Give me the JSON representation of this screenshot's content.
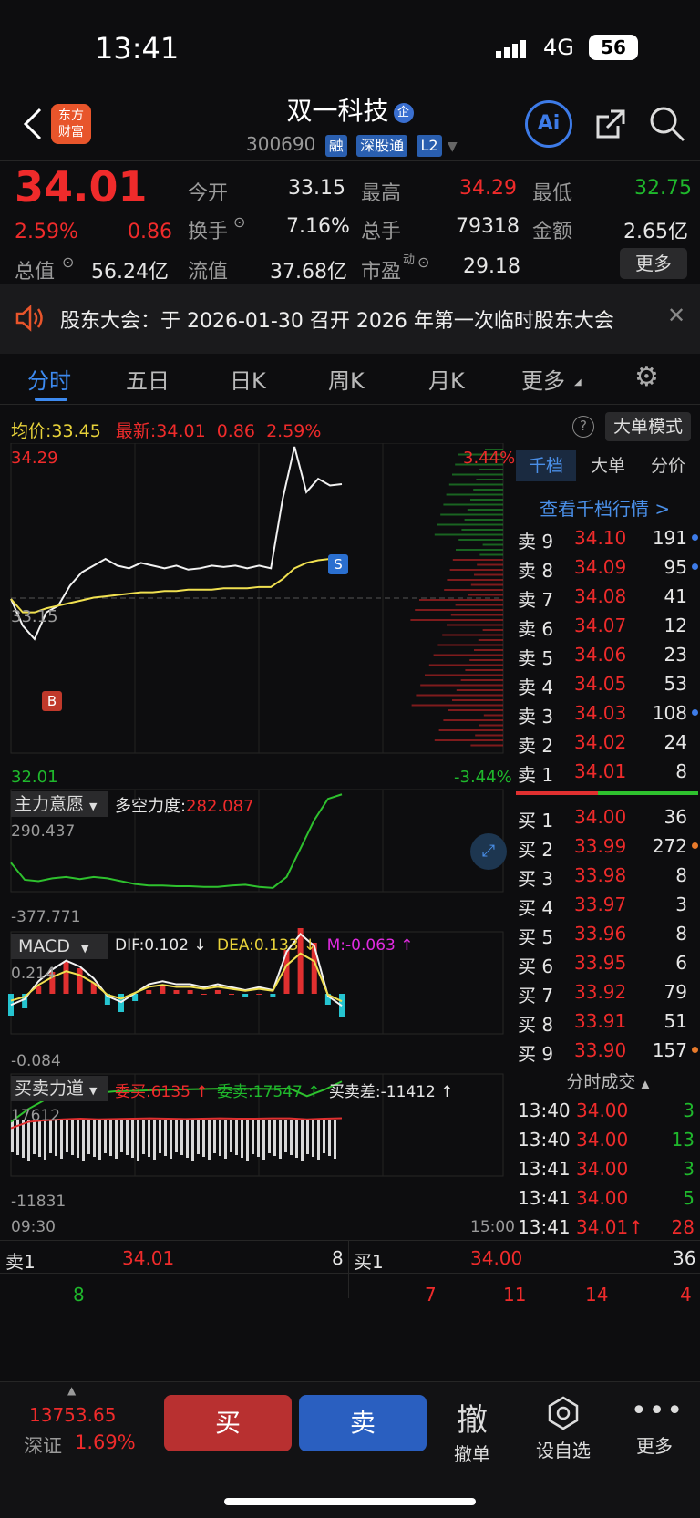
{
  "status": {
    "time": "13:41",
    "network": "4G",
    "battery": "56"
  },
  "header": {
    "logo_line1": "东方",
    "logo_line2": "财富",
    "title": "双一科技",
    "title_badge": "企",
    "code": "300690",
    "tag1": "融",
    "tag2": "深股通",
    "tag3": "L2",
    "ai_label": "Ai"
  },
  "quote": {
    "price": "34.01",
    "pct": "2.59%",
    "change": "0.86",
    "open_label": "今开",
    "open": "33.15",
    "high_label": "最高",
    "high": "34.29",
    "low_label": "最低",
    "low": "32.75",
    "turnover_label": "换手",
    "turnover": "7.16%",
    "vol_label": "总手",
    "vol": "79318",
    "amt_label": "金额",
    "amt": "2.65亿",
    "mktcap_label": "总值",
    "mktcap": "56.24亿",
    "float_label": "流值",
    "float": "37.68亿",
    "pe_label": "市盈",
    "pe_sup": "动",
    "pe": "29.18",
    "more": "更多"
  },
  "announcement": {
    "text": "股东大会：于 2026-01-30 召开 2026 年第一次临时股东大会"
  },
  "tabs": [
    "分时",
    "五日",
    "日K",
    "周K",
    "月K",
    "更多"
  ],
  "chart_header": {
    "avg_label": "均价:",
    "avg": "33.45",
    "last_label": "最新:",
    "last": "34.01",
    "chg": "0.86",
    "pct": "2.59%",
    "mode": "大单模式"
  },
  "chart_data": [
    {
      "type": "line",
      "title": "分时",
      "series": [
        {
          "name": "价格",
          "values": [
            33.15,
            32.95,
            32.85,
            33.05,
            33.1,
            33.25,
            33.35,
            33.4,
            33.45,
            33.4,
            33.38,
            33.42,
            33.4,
            33.38,
            33.4,
            33.37,
            33.38,
            33.4,
            33.39,
            33.4,
            33.38,
            33.4,
            33.38,
            33.9,
            34.29,
            33.95,
            34.05,
            34.0,
            34.01
          ]
        },
        {
          "name": "均价",
          "values": [
            33.15,
            33.05,
            33.05,
            33.08,
            33.1,
            33.12,
            33.14,
            33.16,
            33.17,
            33.18,
            33.19,
            33.2,
            33.2,
            33.21,
            33.21,
            33.22,
            33.22,
            33.22,
            33.23,
            33.23,
            33.23,
            33.24,
            33.24,
            33.3,
            33.38,
            33.42,
            33.44,
            33.45,
            33.45
          ]
        }
      ],
      "ylim": [
        32.01,
        34.29
      ],
      "ytick_top": "34.29",
      "ytick_mid": "33.15",
      "ytick_bottom": "32.01",
      "pct_top": "3.44%",
      "pct_bottom": "-3.44%",
      "xtick_start": "09:30",
      "xtick_end": "15:00",
      "markers": [
        "B",
        "S"
      ]
    },
    {
      "type": "line",
      "title": "主力意愿",
      "sub_label": "多空力度:",
      "sub_value": "282.087",
      "ytick_top": "290.437",
      "ytick_bottom": "-377.771",
      "values": [
        -200,
        -320,
        -330,
        -310,
        -300,
        -315,
        -300,
        -310,
        -330,
        -350,
        -360,
        -360,
        -365,
        -365,
        -370,
        -370,
        -360,
        -355,
        -370,
        -377,
        -300,
        -100,
        100,
        250,
        282
      ]
    },
    {
      "type": "bar",
      "title": "MACD",
      "dif_label": "DIF:0.102 ↓",
      "dea_label": "DEA:0.133 ↓",
      "m_label": "M:-0.063 ↑",
      "ytick_top": "0.214",
      "ytick_bottom": "-0.084",
      "values": [
        -0.06,
        -0.04,
        0.02,
        0.06,
        0.09,
        0.07,
        0.03,
        -0.03,
        -0.05,
        -0.02,
        0.01,
        0.02,
        0.01,
        0.01,
        0.0,
        0.01,
        0.0,
        -0.01,
        0.0,
        -0.01,
        0.12,
        0.18,
        0.14,
        -0.03,
        -0.063
      ]
    },
    {
      "type": "line",
      "title": "买卖力道",
      "buy_label": "委买:6135 ↑",
      "sell_label": "委卖:17547 ↑",
      "diff_label": "买卖差:-11412 ↑",
      "ytick_top": "17612",
      "ytick_bottom": "-11831",
      "series": [
        {
          "name": "委卖",
          "values": [
            5000,
            9000,
            12000,
            13000,
            13500,
            14000,
            14500,
            14600,
            14800,
            15000,
            15100,
            15200,
            15300,
            15200,
            15300,
            15200,
            15400,
            13000,
            15000,
            17547
          ]
        },
        {
          "name": "委买",
          "values": [
            3000,
            5000,
            5500,
            5800,
            6000,
            5800,
            5900,
            6000,
            6100,
            6000,
            5900,
            6000,
            6100,
            6000,
            6000,
            6100,
            6100,
            5800,
            6000,
            6135
          ]
        }
      ]
    }
  ],
  "orderbook": {
    "tabs": [
      "千档",
      "大单",
      "分价"
    ],
    "link": "查看千档行情 >",
    "asks": [
      {
        "label": "卖 9",
        "price": "34.10",
        "qty": "191"
      },
      {
        "label": "卖 8",
        "price": "34.09",
        "qty": "95"
      },
      {
        "label": "卖 7",
        "price": "34.08",
        "qty": "41"
      },
      {
        "label": "卖 6",
        "price": "34.07",
        "qty": "12"
      },
      {
        "label": "卖 5",
        "price": "34.06",
        "qty": "23"
      },
      {
        "label": "卖 4",
        "price": "34.05",
        "qty": "53"
      },
      {
        "label": "卖 3",
        "price": "34.03",
        "qty": "108"
      },
      {
        "label": "卖 2",
        "price": "34.02",
        "qty": "24"
      },
      {
        "label": "卖 1",
        "price": "34.01",
        "qty": "8"
      }
    ],
    "bids": [
      {
        "label": "买 1",
        "price": "34.00",
        "qty": "36"
      },
      {
        "label": "买 2",
        "price": "33.99",
        "qty": "272"
      },
      {
        "label": "买 3",
        "price": "33.98",
        "qty": "8"
      },
      {
        "label": "买 4",
        "price": "33.97",
        "qty": "3"
      },
      {
        "label": "买 5",
        "price": "33.96",
        "qty": "8"
      },
      {
        "label": "买 6",
        "price": "33.95",
        "qty": "6"
      },
      {
        "label": "买 7",
        "price": "33.92",
        "qty": "79"
      },
      {
        "label": "买 8",
        "price": "33.91",
        "qty": "51"
      },
      {
        "label": "买 9",
        "price": "33.90",
        "qty": "157"
      }
    ],
    "trades_title": "分时成交",
    "trades": [
      {
        "time": "13:40",
        "price": "34.00",
        "qty": "3"
      },
      {
        "time": "13:40",
        "price": "34.00",
        "qty": "13"
      },
      {
        "time": "13:41",
        "price": "34.00",
        "qty": "3"
      },
      {
        "time": "13:41",
        "price": "34.00",
        "qty": "5"
      },
      {
        "time": "13:41",
        "price": "34.01↑",
        "qty": "28"
      }
    ]
  },
  "level1": {
    "sell_label": "卖1",
    "sell_price": "34.01",
    "sell_qty": "8",
    "buy_label": "买1",
    "buy_price": "34.00",
    "buy_qty": "36",
    "sell_queue": [
      "8"
    ],
    "buy_queue": [
      "7",
      "11",
      "14",
      "4"
    ]
  },
  "bottom": {
    "index_value": "13753.65",
    "index_name": "深证",
    "index_pct": "1.69%",
    "buy": "买",
    "sell": "卖",
    "cancel_glyph": "撤",
    "cancel": "撤单",
    "watch": "设自选",
    "more": "更多"
  }
}
